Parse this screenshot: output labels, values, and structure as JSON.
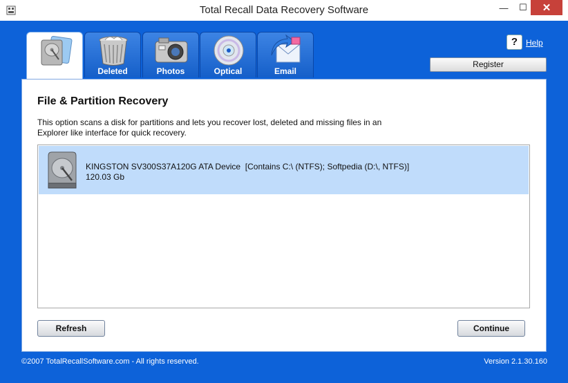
{
  "window": {
    "title": "Total Recall Data Recovery Software",
    "minimize": "—",
    "maximize": "☐",
    "close": "✕"
  },
  "tabs": [
    {
      "label": "",
      "icon": "hard-drive-icon",
      "active": true
    },
    {
      "label": "Deleted",
      "icon": "recycle-bin-icon"
    },
    {
      "label": "Photos",
      "icon": "camera-icon"
    },
    {
      "label": "Optical",
      "icon": "disc-icon"
    },
    {
      "label": "Email",
      "icon": "email-icon"
    }
  ],
  "header": {
    "help_icon": "?",
    "help_label": "Help",
    "register_label": "Register"
  },
  "panel": {
    "title": "File & Partition Recovery",
    "description": "This option scans a disk for partitions and lets you recover lost, deleted and missing files in an Explorer like interface for quick recovery."
  },
  "disks": [
    {
      "name": "KINGSTON SV300S37A120G ATA Device  [Contains C:\\ (NTFS); Softpedia (D:\\, NTFS)]",
      "size": "120.03 Gb"
    }
  ],
  "buttons": {
    "refresh": "Refresh",
    "continue": "Continue"
  },
  "footer": {
    "copyright": "©2007 TotalRecallSoftware.com - All rights reserved.",
    "version": "Version 2.1.30.160"
  },
  "colors": {
    "window_blue": "#0d62d9",
    "selection": "#c0dcfb",
    "close_red": "#c7413a"
  }
}
